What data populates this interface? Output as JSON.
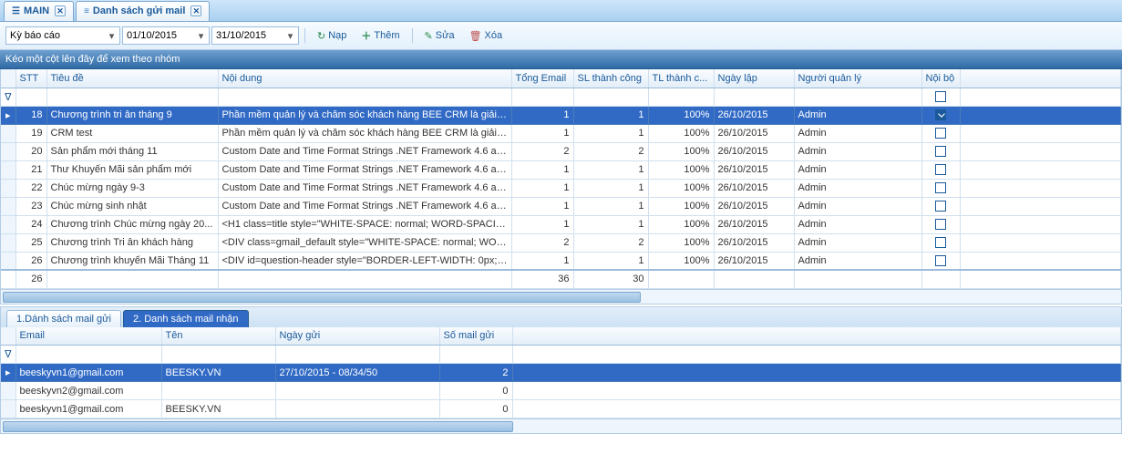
{
  "tabs": [
    {
      "label": "MAIN"
    },
    {
      "label": "Danh sách gửi mail"
    }
  ],
  "toolbar": {
    "report_sel": "Kỳ báo cáo",
    "date_from": "01/10/2015",
    "date_to": "31/10/2015",
    "reload": "Nạp",
    "add": "Thêm",
    "edit": "Sửa",
    "delete": "Xóa"
  },
  "group_hint": "Kéo một cột lên đây để xem theo nhóm",
  "columns": {
    "stt": "STT",
    "tieude": "Tiêu đề",
    "noidung": "Nội dung",
    "tongemail": "Tổng Email",
    "sltc": "SL thành công",
    "tltc": "TL thành c...",
    "ngaylap": "Ngày lập",
    "nguoiql": "Người quản lý",
    "noibo": "Nội bộ"
  },
  "rows": [
    {
      "stt": 18,
      "title": "Chương trình tri ân tháng 9",
      "content": "Phần mềm quản lý và chăm sóc khách hàng BEE CRM là giải phá...",
      "total": 1,
      "succ": 1,
      "rate": "100%",
      "date": "26/10/2015",
      "mgr": "Admin",
      "sel": true,
      "checked": true
    },
    {
      "stt": 19,
      "title": "CRM test",
      "content": "Phần mềm quản lý và chăm sóc khách hàng BEE CRM là giải phá...",
      "total": 1,
      "succ": 1,
      "rate": "100%",
      "date": "26/10/2015",
      "mgr": "Admin"
    },
    {
      "stt": 20,
      "title": "Sản phẩm mới tháng 11",
      "content": "Custom Date and Time Format Strings .NET Framework 4.6 and...",
      "total": 2,
      "succ": 2,
      "rate": "100%",
      "date": "26/10/2015",
      "mgr": "Admin"
    },
    {
      "stt": 21,
      "title": "Thư Khuyến Mãi sản phẩm mới",
      "content": "Custom Date and Time Format Strings .NET Framework 4.6 and...",
      "total": 1,
      "succ": 1,
      "rate": "100%",
      "date": "26/10/2015",
      "mgr": "Admin"
    },
    {
      "stt": 22,
      "title": "Chúc mừng ngày 9-3",
      "content": "Custom Date and Time Format Strings .NET Framework 4.6 and...",
      "total": 1,
      "succ": 1,
      "rate": "100%",
      "date": "26/10/2015",
      "mgr": "Admin"
    },
    {
      "stt": 23,
      "title": "Chúc mừng sinh nhật",
      "content": "Custom Date and Time Format Strings .NET Framework 4.6 and...",
      "total": 1,
      "succ": 1,
      "rate": "100%",
      "date": "26/10/2015",
      "mgr": "Admin"
    },
    {
      "stt": 24,
      "title": "Chương trình Chúc mừng ngày 20...",
      "content": "<H1 class=title style=\"WHITE-SPACE: normal; WORD-SPACIN...",
      "total": 1,
      "succ": 1,
      "rate": "100%",
      "date": "26/10/2015",
      "mgr": "Admin"
    },
    {
      "stt": 25,
      "title": "Chương trình Tri ân khách hàng",
      "content": "<DIV class=gmail_default style=\"WHITE-SPACE: normal; WOR...",
      "total": 2,
      "succ": 2,
      "rate": "100%",
      "date": "26/10/2015",
      "mgr": "Admin"
    },
    {
      "stt": 26,
      "title": "Chương trình khuyến Mãi Tháng 11",
      "content": "<DIV id=question-header style=\"BORDER-LEFT-WIDTH: 0px; ...",
      "total": 1,
      "succ": 1,
      "rate": "100%",
      "date": "26/10/2015",
      "mgr": "Admin"
    }
  ],
  "summary": {
    "count": 26,
    "total": 36,
    "succ": 30
  },
  "inner_tabs": {
    "t1": "1.Dánh sách mail gửi",
    "t2": "2. Danh sách mail nhận"
  },
  "cols2": {
    "email": "Email",
    "ten": "Tên",
    "ngaygui": "Ngày gửi",
    "somail": "Số mail gửi"
  },
  "rows2": [
    {
      "email": "beeskyvn1@gmail.com",
      "ten": "BEESKY.VN",
      "ngay": "27/10/2015 - 08/34/50",
      "cnt": 2,
      "sel": true
    },
    {
      "email": "beeskyvn2@gmail.com",
      "ten": "",
      "ngay": "",
      "cnt": 0
    },
    {
      "email": "beeskyvn1@gmail.com",
      "ten": "BEESKY.VN",
      "ngay": "",
      "cnt": 0
    }
  ]
}
